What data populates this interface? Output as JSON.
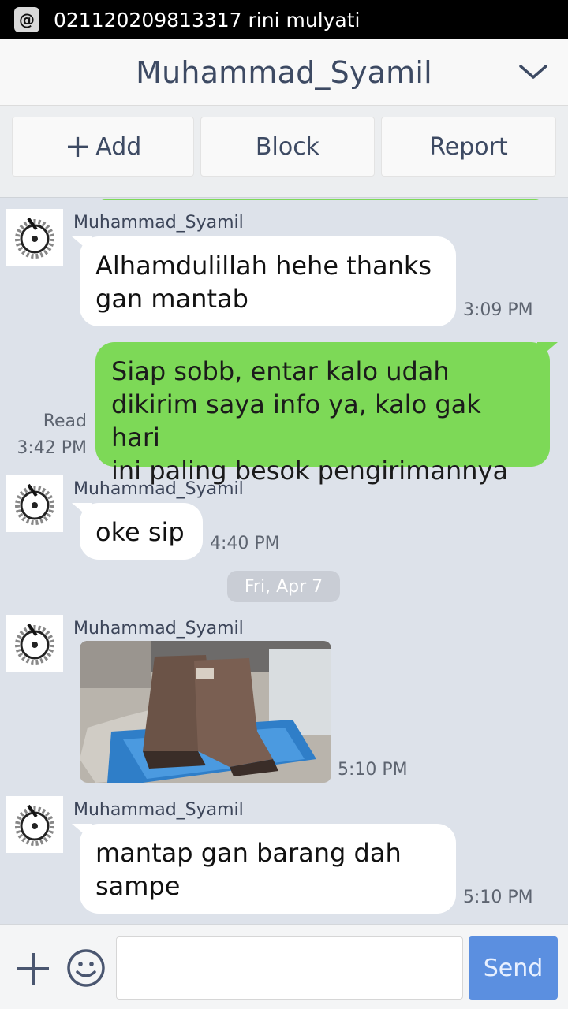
{
  "status_bar": {
    "icon": "at-sign-icon",
    "text": "021120209813317 rini mulyati"
  },
  "header": {
    "title": "Muhammad_Syamil",
    "chevron_icon": "chevron-down-icon"
  },
  "actions": {
    "add_label": "Add",
    "block_label": "Block",
    "report_label": "Report"
  },
  "messages": [
    {
      "direction": "in",
      "sender": "Muhammad_Syamil",
      "text_line1": "Alhamdulillah hehe thanks",
      "text_line2": "gan mantab",
      "time": "3:09 PM"
    },
    {
      "direction": "out",
      "text_line1": "Siap sobb, entar kalo udah",
      "text_line2": "dikirim saya info ya, kalo gak hari",
      "text_line3": "ini paling besok pengirimannya",
      "read": "Read",
      "time": "3:42 PM"
    },
    {
      "direction": "in",
      "sender": "Muhammad_Syamil",
      "text": "oke sip",
      "time": "4:40 PM"
    },
    {
      "direction": "in",
      "sender": "Muhammad_Syamil",
      "type": "image",
      "time": "5:10 PM"
    },
    {
      "direction": "in",
      "sender": "Muhammad_Syamil",
      "text_line1": "mantap gan barang dah",
      "text_line2": "sampe",
      "time": "5:10 PM"
    }
  ],
  "date_separator": "Fri, Apr 7",
  "input_bar": {
    "placeholder": "",
    "send_label": "Send"
  },
  "colors": {
    "outgoing_bubble": "#7dd957",
    "incoming_bubble": "#ffffff",
    "chat_bg": "#dde2ea",
    "send_button": "#5b8fe0",
    "title_text": "#3d4a63"
  }
}
